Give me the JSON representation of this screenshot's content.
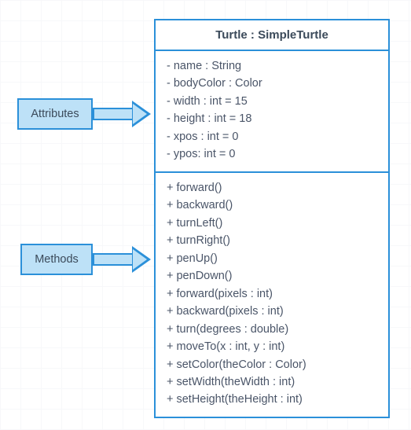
{
  "labels": {
    "attributes": "Attributes",
    "methods": "Methods"
  },
  "class": {
    "header": "Turtle : SimpleTurtle",
    "attributes": [
      "- name : String",
      "- bodyColor : Color",
      "- width : int = 15",
      "- height : int = 18",
      "- xpos : int = 0",
      "- ypos: int = 0"
    ],
    "methods": [
      "+ forward()",
      "+ backward()",
      "+ turnLeft()",
      "+ turnRight()",
      "+ penUp()",
      "+ penDown()",
      "+ forward(pixels : int)",
      "+ backward(pixels : int)",
      "+ turn(degrees : double)",
      "+ moveTo(x : int, y : int)",
      "+ setColor(theColor : Color)",
      "+ setWidth(theWidth : int)",
      "+ setHeight(theHeight : int)"
    ]
  },
  "chart_data": {
    "type": "table",
    "title": "UML Class Diagram — Turtle : SimpleTurtle",
    "class_name": "Turtle",
    "superclass": "SimpleTurtle",
    "attributes": [
      {
        "visibility": "-",
        "name": "name",
        "type": "String"
      },
      {
        "visibility": "-",
        "name": "bodyColor",
        "type": "Color"
      },
      {
        "visibility": "-",
        "name": "width",
        "type": "int",
        "default": 15
      },
      {
        "visibility": "-",
        "name": "height",
        "type": "int",
        "default": 18
      },
      {
        "visibility": "-",
        "name": "xpos",
        "type": "int",
        "default": 0
      },
      {
        "visibility": "-",
        "name": "ypos",
        "type": "int",
        "default": 0
      }
    ],
    "methods": [
      {
        "visibility": "+",
        "name": "forward",
        "params": []
      },
      {
        "visibility": "+",
        "name": "backward",
        "params": []
      },
      {
        "visibility": "+",
        "name": "turnLeft",
        "params": []
      },
      {
        "visibility": "+",
        "name": "turnRight",
        "params": []
      },
      {
        "visibility": "+",
        "name": "penUp",
        "params": []
      },
      {
        "visibility": "+",
        "name": "penDown",
        "params": []
      },
      {
        "visibility": "+",
        "name": "forward",
        "params": [
          {
            "name": "pixels",
            "type": "int"
          }
        ]
      },
      {
        "visibility": "+",
        "name": "backward",
        "params": [
          {
            "name": "pixels",
            "type": "int"
          }
        ]
      },
      {
        "visibility": "+",
        "name": "turn",
        "params": [
          {
            "name": "degrees",
            "type": "double"
          }
        ]
      },
      {
        "visibility": "+",
        "name": "moveTo",
        "params": [
          {
            "name": "x",
            "type": "int"
          },
          {
            "name": "y",
            "type": "int"
          }
        ]
      },
      {
        "visibility": "+",
        "name": "setColor",
        "params": [
          {
            "name": "theColor",
            "type": "Color"
          }
        ]
      },
      {
        "visibility": "+",
        "name": "setWidth",
        "params": [
          {
            "name": "theWidth",
            "type": "int"
          }
        ]
      },
      {
        "visibility": "+",
        "name": "setHeight",
        "params": [
          {
            "name": "theHeight",
            "type": "int"
          }
        ]
      }
    ]
  }
}
